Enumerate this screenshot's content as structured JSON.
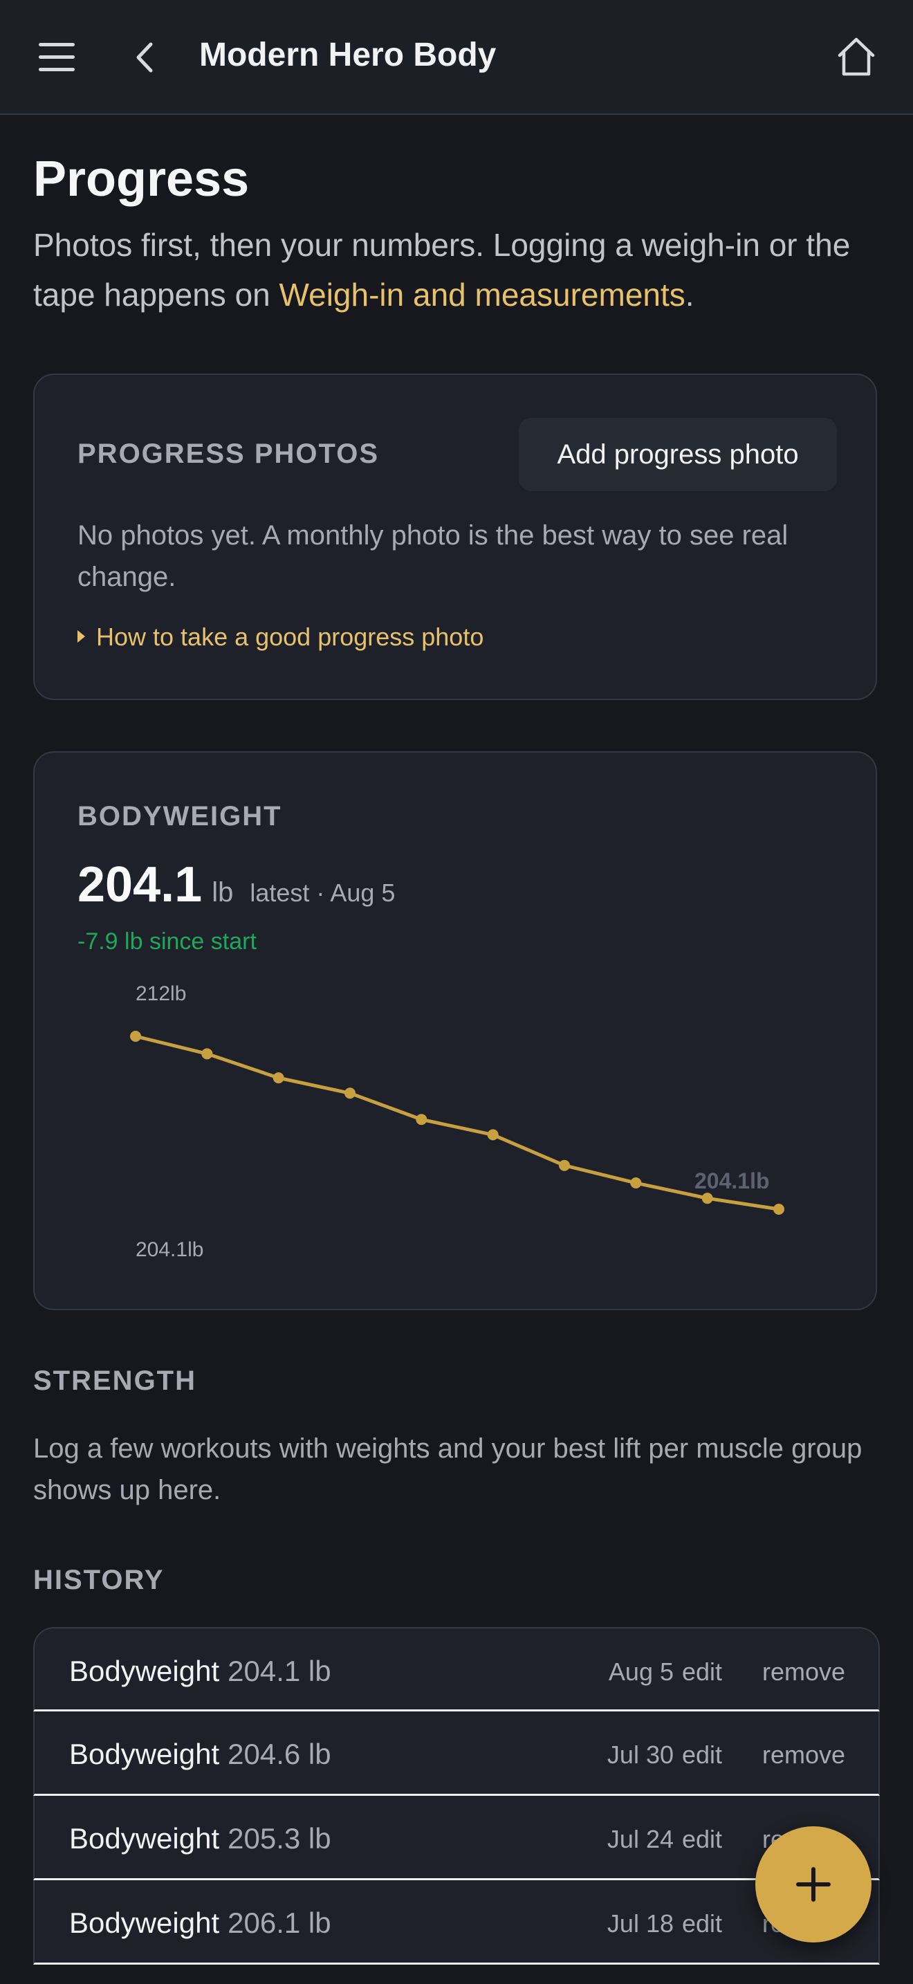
{
  "header": {
    "title": "Modern Hero Body",
    "menu_icon": "menu-icon",
    "back_icon": "chevron-left-icon",
    "home_icon": "home-icon"
  },
  "page": {
    "title": "Progress",
    "intro_before": "Photos first, then your numbers. Logging a weigh-in or the tape happens on ",
    "intro_link": "Weigh-in and measurements",
    "intro_after": "."
  },
  "photos": {
    "label": "PROGRESS PHOTOS",
    "add_button": "Add progress photo",
    "empty_text": "No photos yet. A monthly photo is the best way to see real change.",
    "howto_link": "How to take a good progress photo"
  },
  "bodyweight": {
    "label": "BODYWEIGHT",
    "value": "204.1",
    "unit": "lb",
    "latest": "latest · Aug 5",
    "delta": "-7.9 lb since start"
  },
  "chart_data": {
    "type": "line",
    "title": "",
    "series": [
      {
        "values": [
          212.0,
          211.2,
          210.1,
          209.4,
          208.2,
          207.5,
          206.1,
          205.3,
          204.6,
          204.1
        ]
      }
    ],
    "ylim": [
      204.1,
      212
    ],
    "max_label": "212lb",
    "min_label": "204.1lb",
    "last_label": "204.1lb",
    "grid": false,
    "line_color": "#c9a03f"
  },
  "strength": {
    "label": "STRENGTH",
    "empty_text": "Log a few workouts with weights and your best lift per muscle group shows up here."
  },
  "history": {
    "label": "HISTORY",
    "edit_label": "edit",
    "remove_label": "remove",
    "rows": [
      {
        "name": "Bodyweight",
        "amount": "204.1 lb",
        "date": "Aug 5"
      },
      {
        "name": "Bodyweight",
        "amount": "204.6 lb",
        "date": "Jul 30"
      },
      {
        "name": "Bodyweight",
        "amount": "205.3 lb",
        "date": "Jul 24"
      },
      {
        "name": "Bodyweight",
        "amount": "206.1 lb",
        "date": "Jul 18"
      }
    ]
  },
  "fab": {
    "icon": "plus-icon"
  },
  "colors": {
    "accent": "#e8c26a",
    "fab": "#d4a94a",
    "positive": "#1fa85a",
    "background": "#16181d",
    "card": "#1e2129"
  }
}
